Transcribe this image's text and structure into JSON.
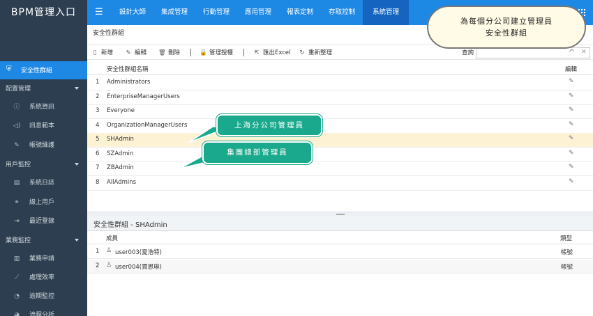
{
  "app": {
    "title": "BPM管理入口"
  },
  "nav": {
    "tabs": [
      "設計大師",
      "集成管理",
      "行動管理",
      "應用管理",
      "報表定制",
      "存取控制",
      "系統管理"
    ],
    "active_tab": "系統管理"
  },
  "sidebar": {
    "active_item": "安全性群組",
    "groups": [
      {
        "label": "配置管理",
        "items": [
          "系統資訊",
          "訊息範本",
          "帳號維護"
        ]
      },
      {
        "label": "用戶監控",
        "items": [
          "系統日誌",
          "線上用戶",
          "最近登錄"
        ]
      },
      {
        "label": "業務監控",
        "items": [
          "業務申請",
          "處理效率",
          "逾期監控",
          "流程分析"
        ]
      }
    ]
  },
  "main": {
    "panel_title": "安全性群組",
    "toolbar": {
      "add": "新增",
      "edit": "編輯",
      "delete": "刪除",
      "manage": "管理授權",
      "export": "匯出Excel",
      "refresh": "重新整理",
      "query_label": "查詢"
    },
    "table": {
      "col_name": "安全性群組名稱",
      "col_edit": "編輯",
      "rows": [
        "Administrators",
        "EnterpriseManagerUsers",
        "Everyone",
        "OrganizationManagerUsers",
        "SHAdmin",
        "SZAdmin",
        "ZBAdmin",
        "AllAdmins"
      ],
      "selected": "SHAdmin"
    },
    "detail": {
      "title": "安全性群組 - SHAdmin",
      "col_member": "成員",
      "col_type": "類型",
      "rows": [
        {
          "name": "user003(夏浩特)",
          "type": "帳號"
        },
        {
          "name": "user004(賈思琳)",
          "type": "帳號"
        }
      ]
    }
  },
  "annotations": {
    "cloud": [
      "為每個分公司建立管理員",
      "安全性群組"
    ],
    "callout_sh": "上海分公司管理員",
    "callout_hq": "集團總部管理員"
  },
  "colors": {
    "primary": "#1e88e5",
    "sidebar": "#2d3e50",
    "highlight_row": "#fdf3d4",
    "callout": "#1aa98c"
  }
}
